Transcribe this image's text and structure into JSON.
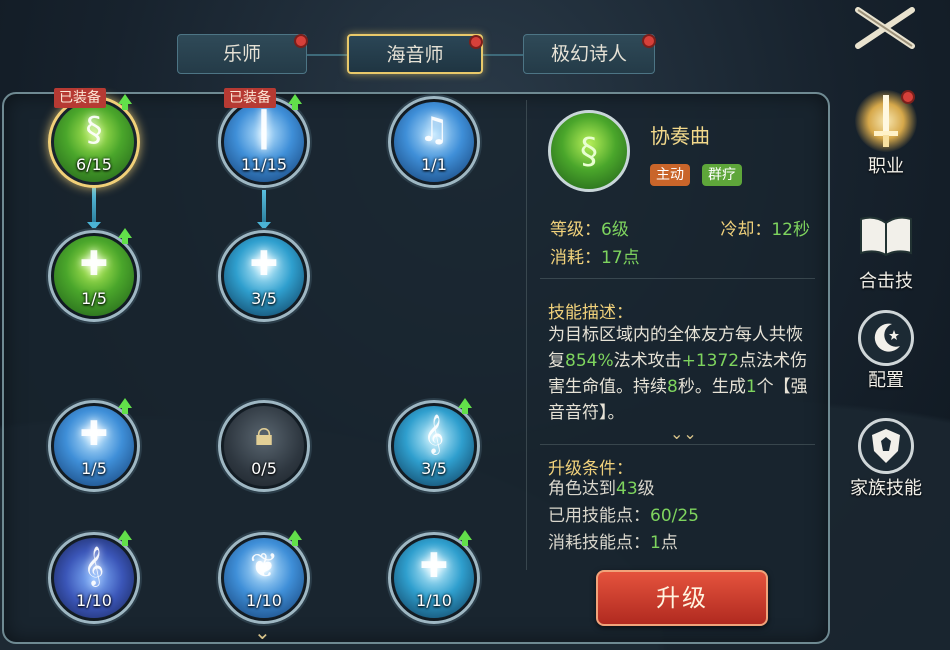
{
  "tabs": [
    {
      "label": "乐师",
      "active": false,
      "has_dot": true
    },
    {
      "label": "海音师",
      "active": true,
      "has_dot": true
    },
    {
      "label": "极幻诗人",
      "active": false,
      "has_dot": true
    }
  ],
  "rail": {
    "items": [
      {
        "label": "职业",
        "icon": "sword-icon",
        "active": true,
        "has_dot": true
      },
      {
        "label": "合击技",
        "icon": "book-icon",
        "active": false,
        "has_dot": false
      },
      {
        "label": "配置",
        "icon": "moon-icon",
        "active": false,
        "has_dot": false
      },
      {
        "label": "家族技能",
        "icon": "crest-icon",
        "active": false,
        "has_dot": false
      }
    ]
  },
  "tree": {
    "equipped_label": "已装备",
    "nodes": [
      {
        "count": "6/15",
        "icon": "serpent-heal-icon",
        "equipped": true,
        "upgradable": true,
        "selected": true
      },
      {
        "count": "11/15",
        "icon": "light-pillar-icon",
        "equipped": true,
        "upgradable": true,
        "selected": false
      },
      {
        "count": "1/1",
        "icon": "music-clef-icon",
        "equipped": false,
        "upgradable": false,
        "selected": false
      },
      {
        "count": "1/5",
        "icon": "plus-heal-icon",
        "equipped": false,
        "upgradable": true,
        "selected": false
      },
      {
        "count": "3/5",
        "icon": "plus-group-icon",
        "equipped": false,
        "upgradable": false,
        "selected": false
      },
      {
        "count": "1/5",
        "icon": "figure-heal-icon",
        "equipped": false,
        "upgradable": true,
        "selected": false
      },
      {
        "count": "0/5",
        "icon": "lock-icon",
        "equipped": false,
        "upgradable": false,
        "selected": false
      },
      {
        "count": "3/5",
        "icon": "treble-wave-icon",
        "equipped": false,
        "upgradable": true,
        "selected": false
      },
      {
        "count": "1/10",
        "icon": "treble-note-icon",
        "equipped": false,
        "upgradable": true,
        "selected": false
      },
      {
        "count": "1/10",
        "icon": "wings-icon",
        "equipped": false,
        "upgradable": true,
        "selected": false
      },
      {
        "count": "1/10",
        "icon": "plus-figure-icon",
        "equipped": false,
        "upgradable": true,
        "selected": false
      }
    ]
  },
  "detail": {
    "name": "协奏曲",
    "tags": [
      "主动",
      "群疗"
    ],
    "stats": {
      "level_label": "等级：",
      "level_value": "6级",
      "cooldown_label": "冷却：",
      "cooldown_value": "12秒",
      "cost_label": "消耗：",
      "cost_value": "17点"
    },
    "desc_title": "技能描述：",
    "desc": {
      "t1": "为目标区域内的全体友方每人共恢复",
      "v1": "854%",
      "t2": "法术攻击",
      "v2": "+1372",
      "t3": "点法术伤害生命值。持续",
      "v3": "8",
      "t4": "秒。生成",
      "v4": "1",
      "t5": "个【强音音符】。"
    },
    "req_title": "升级条件：",
    "req": {
      "r1_label": "角色达到",
      "r1_value": "43",
      "r1_unit": "级",
      "r2_label": "已用技能点：",
      "r2_value": "60/25",
      "r3_label": "消耗技能点：",
      "r3_value": "1",
      "r3_unit": "点"
    }
  },
  "upgrade_label": "升级",
  "colors": {
    "accent_gold": "#f0d17b",
    "value_green": "#7ed45e",
    "button_red": "#c8382c",
    "badge_red": "#b63a33"
  }
}
